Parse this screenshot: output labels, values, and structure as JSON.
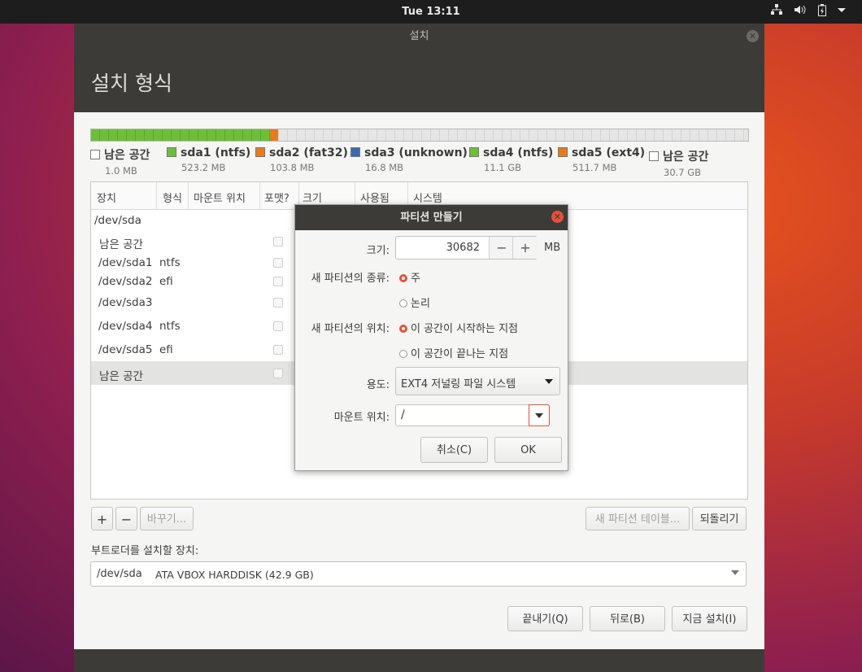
{
  "topbar": {
    "clock": "Tue 13:11",
    "network_icon": "network-icon",
    "volume_icon": "volume-icon",
    "battery_icon": "battery-icon",
    "menu_icon": "chevron-down-icon"
  },
  "window": {
    "title": "설치",
    "header": "설치 형식"
  },
  "legend": [
    {
      "name": "남은 공간",
      "size": "1.0 MB",
      "color": "#ffffff"
    },
    {
      "name": "sda1 (ntfs)",
      "size": "523.2 MB",
      "color": "#6dbf3a"
    },
    {
      "name": "sda2 (fat32)",
      "size": "103.8 MB",
      "color": "#e67a1f"
    },
    {
      "name": "sda3 (unknown)",
      "size": "16.8 MB",
      "color": "#3c69b0"
    },
    {
      "name": "sda4 (ntfs)",
      "size": "11.1 GB",
      "color": "#6dbf3a"
    },
    {
      "name": "sda5 (ext4)",
      "size": "511.7 MB",
      "color": "#e67a1f"
    },
    {
      "name": "남은 공간",
      "size": "30.7 GB",
      "color": "#ffffff"
    }
  ],
  "table": {
    "headers": [
      "장치",
      "형식",
      "마운트 위치",
      "포맷?",
      "크기",
      "사용됨",
      "시스템"
    ],
    "rows": [
      {
        "device": "/dev/sda",
        "type": ""
      },
      {
        "device": "남은 공간",
        "type": ""
      },
      {
        "device": "/dev/sda1",
        "type": "ntfs"
      },
      {
        "device": "/dev/sda2",
        "type": "efi"
      },
      {
        "device": "/dev/sda3",
        "type": ""
      },
      {
        "device": "/dev/sda4",
        "type": "ntfs"
      },
      {
        "device": "/dev/sda5",
        "type": "efi"
      },
      {
        "device": "남은 공간",
        "type": ""
      }
    ]
  },
  "toolbar": {
    "add": "+",
    "remove": "−",
    "change": "바꾸기...",
    "new_table": "새 파티션 테이블...",
    "revert": "되돌리기"
  },
  "bootloader": {
    "label": "부트로더를 설치할 장치:",
    "device": "/dev/sda",
    "description": "ATA VBOX HARDDISK (42.9 GB)"
  },
  "footer": {
    "quit": "끝내기(Q)",
    "back": "뒤로(B)",
    "install": "지금 설치(I)"
  },
  "dialog": {
    "title": "파티션 만들기",
    "size_label": "크기:",
    "size_value": "30682",
    "size_unit": "MB",
    "minus": "−",
    "plus": "+",
    "type_label": "새 파티션의 종류:",
    "type_primary": "주",
    "type_logical": "논리",
    "location_label": "새 파티션의 위치:",
    "location_start": "이 공간이 시작하는 지점",
    "location_end": "이 공간이 끝나는 지점",
    "use_label": "용도:",
    "use_value": "EXT4 저널링 파일 시스템",
    "mount_label": "마운트 위치:",
    "mount_value": "/",
    "cancel": "취소(C)",
    "ok": "OK"
  }
}
